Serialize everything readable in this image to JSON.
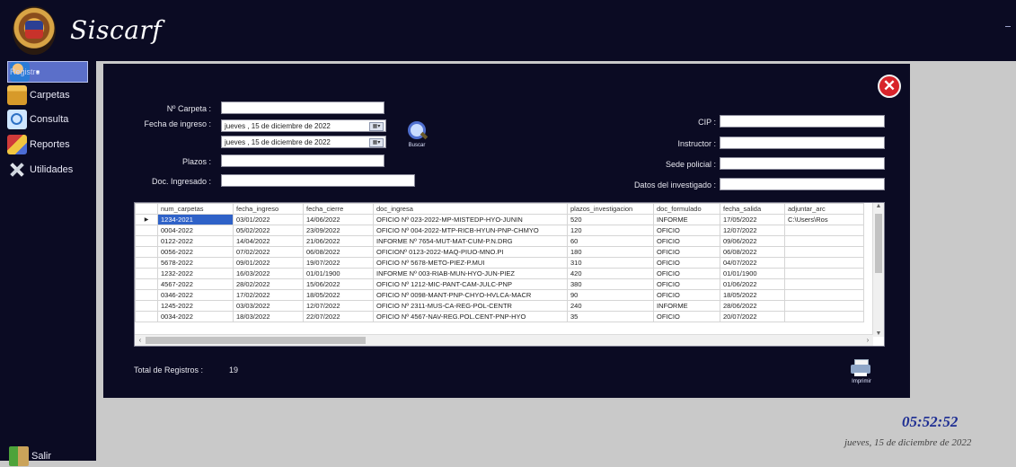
{
  "app": {
    "title": "Siscarf"
  },
  "sidebar": {
    "items": [
      {
        "label": "Registro",
        "icon": "user-icon"
      },
      {
        "label": "Carpetas",
        "icon": "folder-icon"
      },
      {
        "label": "Consulta",
        "icon": "search-icon"
      },
      {
        "label": "Reportes",
        "icon": "report-icon"
      },
      {
        "label": "Utilidades",
        "icon": "tools-icon"
      }
    ],
    "exit_label": "Salir"
  },
  "form": {
    "carpeta_label": "Nº Carpeta :",
    "carpeta_value": "",
    "fecha_label": "Fecha de ingreso :",
    "fecha_desde": "jueves  ,  15 de  diciembre  de  2022",
    "fecha_hasta": "jueves  ,  15 de  diciembre  de  2022",
    "plazos_label": "Plazos :",
    "plazos_value": "",
    "doc_label": "Doc. Ingresado :",
    "doc_value": "",
    "cip_label": "CIP :",
    "cip_value": "",
    "instructor_label": "Instructor :",
    "instructor_value": "",
    "sede_label": "Sede policial :",
    "sede_value": "",
    "investigado_label": "Datos del investigado :",
    "investigado_value": "",
    "buscar_label": "Buscar",
    "imprimir_label": "Imprimir"
  },
  "grid": {
    "columns": [
      "num_carpetas",
      "fecha_ingreso",
      "fecha_cierre",
      "doc_ingresa",
      "plazos_investigacion",
      "doc_formulado",
      "fecha_salida",
      "adjuntar_arc"
    ],
    "rows": [
      [
        "1234-2021",
        "03/01/2022",
        "14/06/2022",
        "OFICIO Nº 023-2022-MP-MISTEDP-HYO-JUNIN",
        "520",
        "INFORME",
        "17/05/2022",
        "C:\\Users\\Ros"
      ],
      [
        "0004-2022",
        "05/02/2022",
        "23/09/2022",
        "OFICIO Nº 004-2022-MTP-RICB-HYUN-PNP-CHMYO",
        "120",
        "OFICIO",
        "12/07/2022",
        ""
      ],
      [
        "0122-2022",
        "14/04/2022",
        "21/06/2022",
        "INFORME Nº 7654-MUT-MAT-CUM-P.N.DRG",
        "60",
        "OFICIO",
        "09/06/2022",
        ""
      ],
      [
        "0056-2022",
        "07/02/2022",
        "06/08/2022",
        "OFICIONº 0123-2022-MAQ-PIUO-MNO.PI",
        "180",
        "OFICIO",
        "06/08/2022",
        ""
      ],
      [
        "5678-2022",
        "09/01/2022",
        "19/07/2022",
        "OFICIO Nº 5678-METO-PIEZ-P.MUI",
        "310",
        "OFICIO",
        "04/07/2022",
        ""
      ],
      [
        "1232-2022",
        "16/03/2022",
        "01/01/1900",
        "INFORME Nº 003-RIAB-MUN-HYO-JUN-PIEZ",
        "420",
        "OFICIO",
        "01/01/1900",
        ""
      ],
      [
        "4567-2022",
        "28/02/2022",
        "15/06/2022",
        "OFICIO Nº 1212-MIC-PANT-CAM-JULC-PNP",
        "380",
        "OFICIO",
        "01/06/2022",
        ""
      ],
      [
        "0346-2022",
        "17/02/2022",
        "18/05/2022",
        "OFICIO Nº 0098-MANT-PNP-CHYO-HVLCA-MACR",
        "90",
        "OFICIO",
        "18/05/2022",
        ""
      ],
      [
        "1245-2022",
        "03/03/2022",
        "12/07/2022",
        "OFICIO Nº 2311-MUS-CA-REG-POL-CENTR",
        "240",
        "INFORME",
        "28/06/2022",
        ""
      ],
      [
        "0034-2022",
        "18/03/2022",
        "22/07/2022",
        "OFICIO Nº 4567-NAV-REG.POL.CENT-PNP-HYO",
        "35",
        "OFICIO",
        "20/07/2022",
        ""
      ]
    ],
    "selected_row": 0
  },
  "footer": {
    "total_label": "Total de Registros :",
    "total_value": "19"
  },
  "status": {
    "clock": "05:52:52",
    "date": "jueves, 15 de diciembre de 2022"
  },
  "colors": {
    "dark_bg": "#0b0b23",
    "app_bg": "#c9c9c9",
    "selection": "#2f62c8",
    "clock": "#1e2e93",
    "close": "#d8242a"
  }
}
